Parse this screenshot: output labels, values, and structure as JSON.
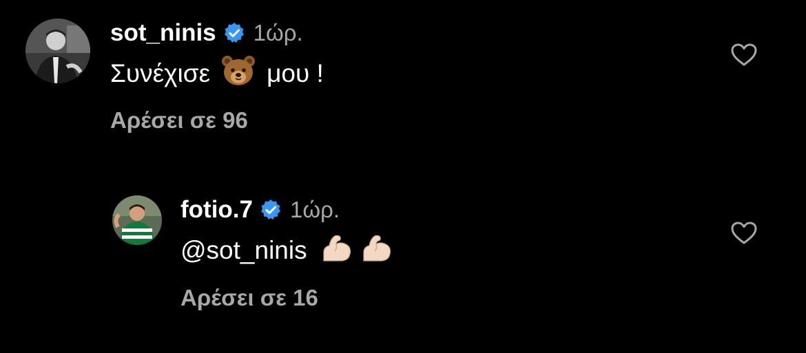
{
  "colors": {
    "background": "#000000",
    "text": "#ffffff",
    "muted": "#a8a8a8",
    "verified": "#3897f0"
  },
  "comments": [
    {
      "username": "sot_ninis",
      "time": "1ώρ.",
      "text_before": "Συνέχισε",
      "emoji": "bear-face-icon",
      "text_after": "μου !",
      "likes": "Αρέσει σε 96"
    },
    {
      "username": "fotio.7",
      "time": "1ώρ.",
      "mention": "@sot_ninis",
      "emoji": "flexed-biceps-icon",
      "likes": "Αρέσει σε 16"
    }
  ]
}
